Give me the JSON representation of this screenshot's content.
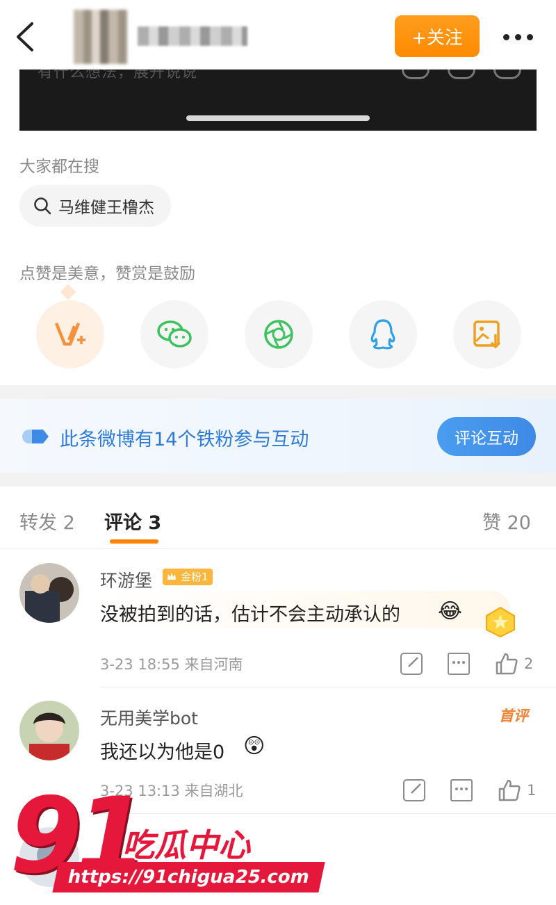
{
  "header": {
    "follow_label": "+关注"
  },
  "composer": {
    "hint": "有什么想法，展开说说"
  },
  "search": {
    "title": "大家都在搜",
    "query": "马维健王橹杰"
  },
  "reward": {
    "title": "点赞是美意，赞赏是鼓励"
  },
  "share_icons": [
    "vip-icon",
    "wechat-icon",
    "moments-icon",
    "qq-icon",
    "save-image-icon"
  ],
  "fans_banner": {
    "text": "此条微博有14个铁粉参与互动",
    "cta": "评论互动"
  },
  "tabs": [
    {
      "label": "转发 2"
    },
    {
      "label": "评论 3"
    },
    {
      "label": "赞 20"
    }
  ],
  "comments": [
    {
      "user": "环游堡",
      "badge": "金粉1",
      "text": "没被拍到的话，估计不会主动承认的",
      "time": "3-23 18:55",
      "location": "来自河南",
      "likes": "2"
    },
    {
      "user": "无用美学bot",
      "tag": "首评",
      "text": "我还以为他是0",
      "time": "3-23 13:13",
      "location": "来自湖北",
      "likes": "1"
    }
  ],
  "watermark": {
    "number": "91",
    "brand": "吃瓜中心",
    "url": "https://91chigua25.com"
  },
  "colors": {
    "accent_orange": "#ff8a00",
    "link_blue": "#2e7bd6",
    "watermark_red": "#e5173a"
  }
}
